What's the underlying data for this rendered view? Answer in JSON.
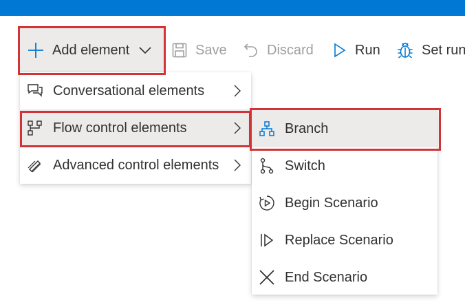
{
  "toolbar": {
    "add_element": "Add element",
    "save": "Save",
    "discard": "Discard",
    "run": "Run",
    "set_run": "Set run"
  },
  "menu": {
    "items": [
      {
        "label": "Conversational elements",
        "icon": "chat-icon"
      },
      {
        "label": "Flow control elements",
        "icon": "flow-icon"
      },
      {
        "label": "Advanced control elements",
        "icon": "pencil-icon"
      }
    ]
  },
  "submenu": {
    "items": [
      {
        "label": "Branch",
        "icon": "branch-icon"
      },
      {
        "label": "Switch",
        "icon": "switch-icon"
      },
      {
        "label": "Begin Scenario",
        "icon": "begin-scenario-icon"
      },
      {
        "label": "Replace Scenario",
        "icon": "replace-scenario-icon"
      },
      {
        "label": "End Scenario",
        "icon": "close-icon"
      }
    ]
  },
  "colors": {
    "brand": "#0078d4",
    "highlight": "#d13438",
    "hover": "#edebe9",
    "disabled": "#a19f9d"
  }
}
